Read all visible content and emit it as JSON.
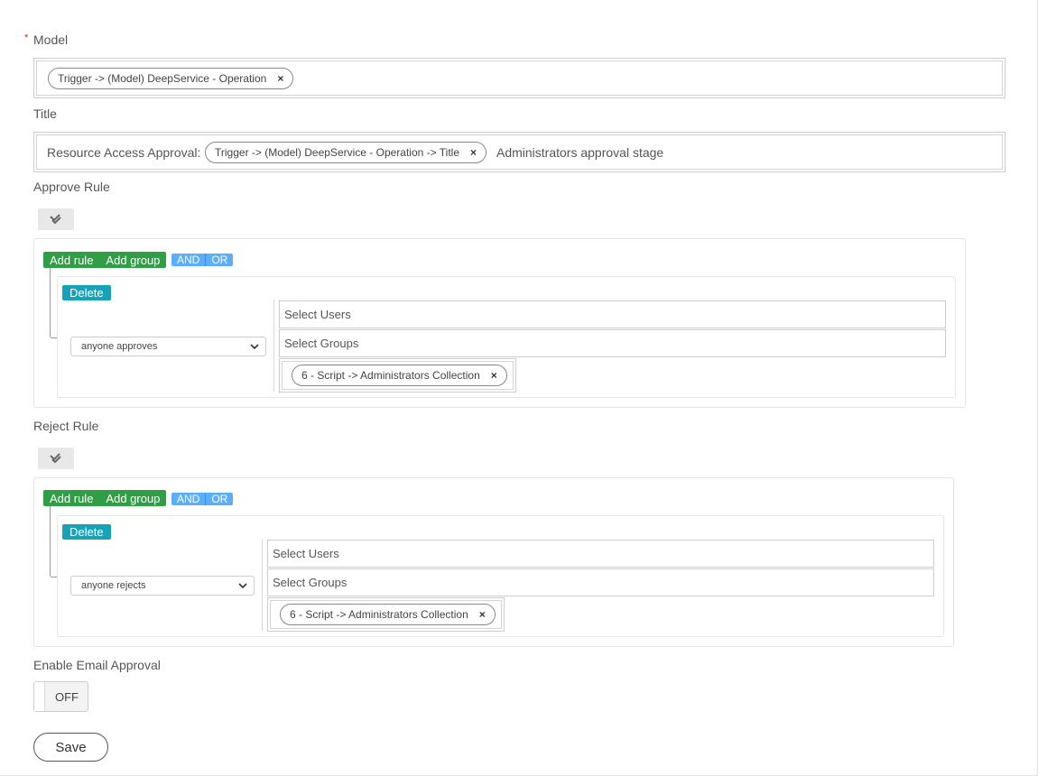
{
  "model": {
    "required_mark": "*",
    "label": "Model",
    "chip_text": "Trigger -> (Model) DeepService - Operation"
  },
  "title": {
    "label": "Title",
    "prefix": "Resource Access Approval:",
    "chip_text": "Trigger -> (Model) DeepService - Operation -> Title",
    "suffix": "Administrators approval stage"
  },
  "approve_rule": {
    "label": "Approve Rule",
    "add_rule": "Add rule",
    "add_group": "Add group",
    "and": "AND",
    "or": "OR",
    "delete": "Delete",
    "select_value": "anyone approves",
    "users_placeholder": "Select Users",
    "groups_placeholder": "Select Groups",
    "group_chip": "6 - Script -> Administrators Collection"
  },
  "reject_rule": {
    "label": "Reject Rule",
    "add_rule": "Add rule",
    "add_group": "Add group",
    "and": "AND",
    "or": "OR",
    "delete": "Delete",
    "select_value": "anyone rejects",
    "users_placeholder": "Select Users",
    "groups_placeholder": "Select Groups",
    "group_chip": "6 - Script -> Administrators Collection"
  },
  "email_approval": {
    "label": "Enable Email Approval",
    "toggle_state": "OFF"
  },
  "save_label": "Save",
  "remove_glyph": "×",
  "colors": {
    "green": "#2f9e44",
    "blue": "#5aaefc",
    "teal": "#17a2b8",
    "required": "#e02020"
  }
}
